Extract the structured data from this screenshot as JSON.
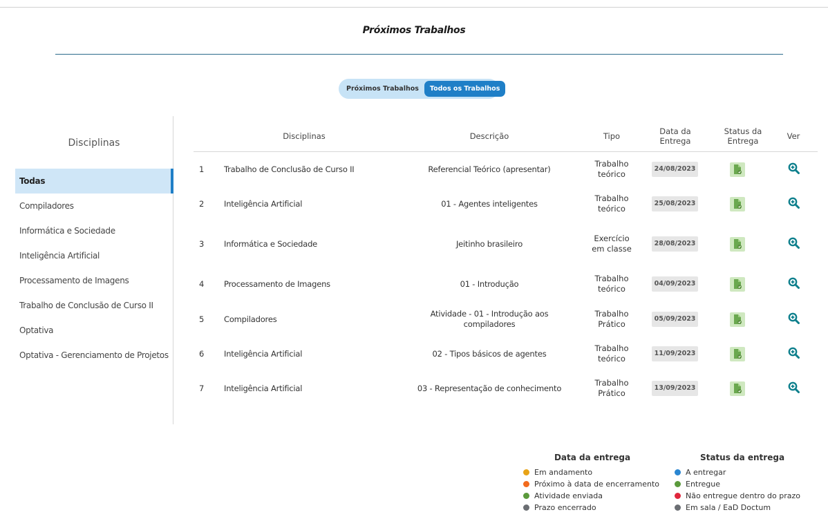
{
  "page_title": "Próximos Trabalhos",
  "toggle": {
    "upcoming_label": "Próximos Trabalhos",
    "all_label": "Todos os Trabalhos"
  },
  "sidebar": {
    "title": "Disciplinas",
    "items": [
      {
        "label": "Todas"
      },
      {
        "label": "Compiladores"
      },
      {
        "label": "Informática e Sociedade"
      },
      {
        "label": "Inteligência Artificial"
      },
      {
        "label": "Processamento de Imagens"
      },
      {
        "label": "Trabalho de Conclusão de Curso II"
      },
      {
        "label": "Optativa"
      },
      {
        "label": "Optativa - Gerenciamento de Projetos"
      }
    ]
  },
  "table": {
    "headers": {
      "disciplinas": "Disciplinas",
      "descricao": "Descrição",
      "tipo": "Tipo",
      "data": "Data da Entrega",
      "status": "Status da Entrega",
      "ver": "Ver"
    },
    "rows": [
      {
        "num": "1",
        "disciplina": "Trabalho de Conclusão de Curso II",
        "descricao": "Referencial Teórico (apresentar)",
        "tipo": "Trabalho teórico",
        "data": "24/08/2023"
      },
      {
        "num": "2",
        "disciplina": "Inteligência Artificial",
        "descricao": "01 - Agentes inteligentes",
        "tipo": "Trabalho teórico",
        "data": "25/08/2023"
      },
      {
        "num": "3",
        "disciplina": "Informática e Sociedade",
        "descricao": "Jeitinho brasileiro",
        "tipo": "Exercício em classe",
        "data": "28/08/2023"
      },
      {
        "num": "4",
        "disciplina": "Processamento de Imagens",
        "descricao": "01 - Introdução",
        "tipo": "Trabalho teórico",
        "data": "04/09/2023"
      },
      {
        "num": "5",
        "disciplina": "Compiladores",
        "descricao": "Atividade - 01 - Introdução aos compiladores",
        "tipo": "Trabalho Prático",
        "data": "05/09/2023"
      },
      {
        "num": "6",
        "disciplina": "Inteligência Artificial",
        "descricao": "02 - Tipos básicos de agentes",
        "tipo": "Trabalho teórico",
        "data": "11/09/2023"
      },
      {
        "num": "7",
        "disciplina": "Inteligência Artificial",
        "descricao": "03 - Representação de conhecimento",
        "tipo": "Trabalho Prático",
        "data": "13/09/2023"
      }
    ]
  },
  "icons": {
    "status": "file-delivered-icon",
    "ver": "zoom-in-icon"
  },
  "legend": {
    "data_title": "Data da entrega",
    "data_items": [
      {
        "label": "Em andamento",
        "color": "#e8a317"
      },
      {
        "label": "Próximo à data de encerramento",
        "color": "#f26b1d"
      },
      {
        "label": "Atividade enviada",
        "color": "#5b9a3c"
      },
      {
        "label": "Prazo encerrado",
        "color": "#6b6e73"
      }
    ],
    "status_title": "Status da entrega",
    "status_items": [
      {
        "label": "A entregar",
        "color": "#2a86d1"
      },
      {
        "label": "Entregue",
        "color": "#5b9a3c"
      },
      {
        "label": "Não entregue dentro do prazo",
        "color": "#e0263c"
      },
      {
        "label": "Em sala / EaD Doctum",
        "color": "#6b6e73"
      }
    ]
  },
  "colors": {
    "accent": "#1f7fc7",
    "status_icon": "#6aa84f",
    "ver_icon": "#0d7f8c"
  }
}
